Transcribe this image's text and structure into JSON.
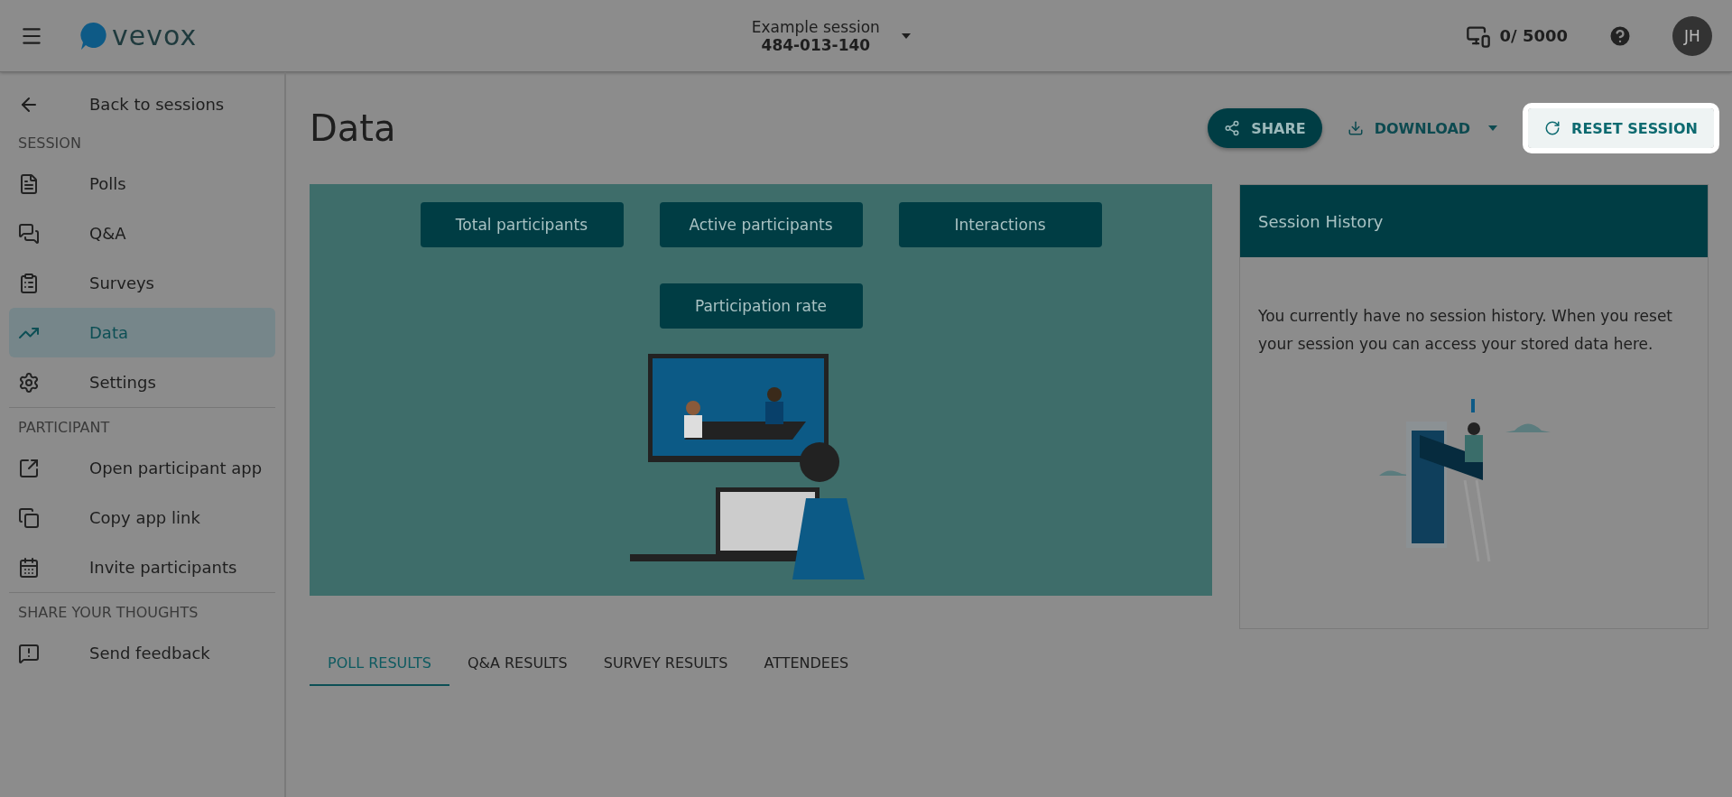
{
  "header": {
    "logo": "vevox",
    "session_name": "Example session",
    "session_code": "484-013-140",
    "participant_count": "0/ 5000",
    "avatar": "JH"
  },
  "sidebar": {
    "back": "Back to sessions",
    "sections": [
      {
        "title": "SESSION",
        "items": [
          {
            "label": "Polls",
            "selected": false
          },
          {
            "label": "Q&A",
            "selected": false
          },
          {
            "label": "Surveys",
            "selected": false
          },
          {
            "label": "Data",
            "selected": true
          },
          {
            "label": "Settings",
            "selected": false
          }
        ]
      },
      {
        "title": "PARTICIPANT",
        "items": [
          {
            "label": "Open participant app",
            "selected": false
          },
          {
            "label": "Copy app link",
            "selected": false
          },
          {
            "label": "Invite participants",
            "selected": false
          }
        ]
      },
      {
        "title": "SHARE YOUR THOUGHTS",
        "items": [
          {
            "label": "Send feedback",
            "selected": false
          }
        ]
      }
    ]
  },
  "page": {
    "title": "Data",
    "actions": [
      {
        "kind": "share",
        "label": "SHARE",
        "highlighted": false
      },
      {
        "kind": "download",
        "label": "DOWNLOAD",
        "highlighted": false
      },
      {
        "kind": "reset",
        "label": "RESET SESSION",
        "highlighted": true
      }
    ]
  },
  "metrics": [
    "Total participants",
    "Active participants",
    "Interactions",
    "Participation rate"
  ],
  "history": {
    "title": "Session History",
    "text": "You currently have no session history. When you reset your session you can access your stored data here."
  },
  "tabs": [
    {
      "label": "POLL RESULTS",
      "selected": true
    },
    {
      "label": "Q&A RESULTS",
      "selected": false
    },
    {
      "label": "SURVEY RESULTS",
      "selected": false
    },
    {
      "label": "ATTENDEES",
      "selected": false
    }
  ]
}
